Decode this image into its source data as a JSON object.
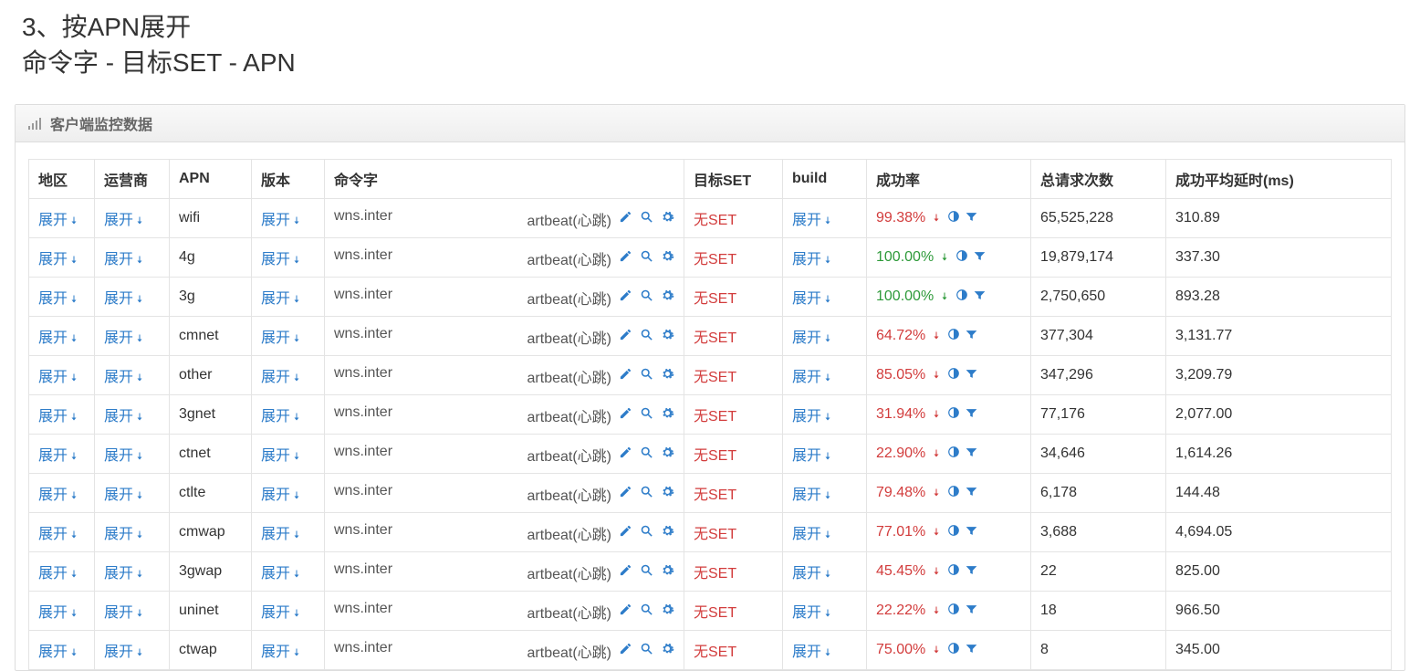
{
  "header": {
    "title": "3、按APN展开",
    "subtitle": "命令字 - 目标SET - APN"
  },
  "panel_title": "客户端监控数据",
  "expand_label": "展开",
  "columns": {
    "region": "地区",
    "carrier": "运营商",
    "apn": "APN",
    "version": "版本",
    "command": "命令字",
    "target_set": "目标SET",
    "build": "build",
    "success_rate": "成功率",
    "total_requests": "总请求次数",
    "avg_delay": "成功平均延时(ms)"
  },
  "command": {
    "prefix": "wns.inter",
    "suffix": "artbeat(心跳)"
  },
  "noset_label": "无SET",
  "rows": [
    {
      "apn": "wifi",
      "rate": "99.38%",
      "rate_dir": "down",
      "requests": "65,525,228",
      "delay": "310.89"
    },
    {
      "apn": "4g",
      "rate": "100.00%",
      "rate_dir": "up",
      "requests": "19,879,174",
      "delay": "337.30"
    },
    {
      "apn": "3g",
      "rate": "100.00%",
      "rate_dir": "up",
      "requests": "2,750,650",
      "delay": "893.28"
    },
    {
      "apn": "cmnet",
      "rate": "64.72%",
      "rate_dir": "down",
      "requests": "377,304",
      "delay": "3,131.77"
    },
    {
      "apn": "other",
      "rate": "85.05%",
      "rate_dir": "down",
      "requests": "347,296",
      "delay": "3,209.79"
    },
    {
      "apn": "3gnet",
      "rate": "31.94%",
      "rate_dir": "down",
      "requests": "77,176",
      "delay": "2,077.00"
    },
    {
      "apn": "ctnet",
      "rate": "22.90%",
      "rate_dir": "down",
      "requests": "34,646",
      "delay": "1,614.26"
    },
    {
      "apn": "ctlte",
      "rate": "79.48%",
      "rate_dir": "down",
      "requests": "6,178",
      "delay": "144.48"
    },
    {
      "apn": "cmwap",
      "rate": "77.01%",
      "rate_dir": "down",
      "requests": "3,688",
      "delay": "4,694.05"
    },
    {
      "apn": "3gwap",
      "rate": "45.45%",
      "rate_dir": "down",
      "requests": "22",
      "delay": "825.00"
    },
    {
      "apn": "uninet",
      "rate": "22.22%",
      "rate_dir": "down",
      "requests": "18",
      "delay": "966.50"
    },
    {
      "apn": "ctwap",
      "rate": "75.00%",
      "rate_dir": "down",
      "requests": "8",
      "delay": "345.00"
    }
  ]
}
